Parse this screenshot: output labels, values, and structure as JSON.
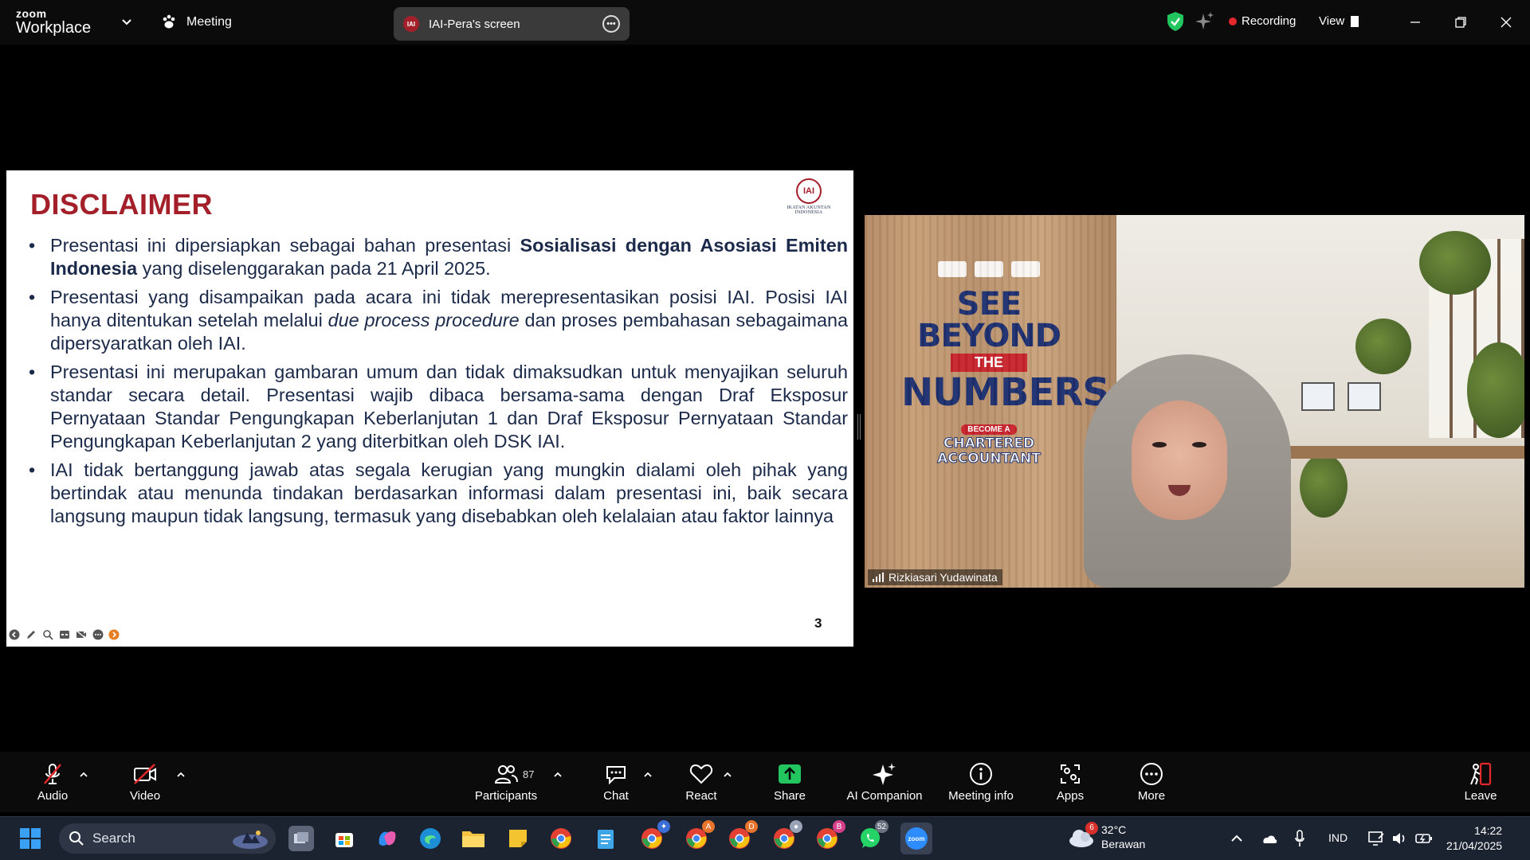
{
  "app": {
    "brand_top": "zoom",
    "brand_bottom": "Workplace",
    "meeting_label": "Meeting",
    "screen_share_title": "IAI-Pera's screen",
    "screen_share_logo": "IAI",
    "recording_label": "Recording",
    "view_label": "View",
    "recording_color": "#e5282c"
  },
  "slide": {
    "title": "DISCLAIMER",
    "logo_text": "IAI",
    "logo_sub": "IKATAN AKUNTAN INDONESIA",
    "page_number": "3",
    "bullets": [
      {
        "parts": [
          {
            "t": "Presentasi ini dipersiapkan sebagai bahan presentasi "
          },
          {
            "t": "Sosialisasi dengan Asosiasi Emiten Indonesia",
            "b": true
          },
          {
            "t": " yang diselenggarakan pada 21 April 2025."
          }
        ]
      },
      {
        "parts": [
          {
            "t": "Presentasi yang disampaikan pada acara ini tidak merepresentasikan posisi IAI. Posisi IAI hanya ditentukan setelah melalui "
          },
          {
            "t": "due process procedure",
            "i": true
          },
          {
            "t": " dan proses pembahasan sebagaimana dipersyaratkan oleh IAI."
          }
        ]
      },
      {
        "parts": [
          {
            "t": "Presentasi ini merupakan gambaran umum dan tidak dimaksudkan untuk menyajikan seluruh standar secara detail. Presentasi wajib dibaca bersama-sama dengan Draf Eksposur Pernyataan Standar Pengungkapan Keberlanjutan 1 dan Draf Eksposur Pernyataan Standar Pengungkapan Keberlanjutan 2 yang diterbitkan oleh DSK IAI."
          }
        ]
      },
      {
        "parts": [
          {
            "t": "IAI tidak bertanggung jawab atas segala kerugian yang mungkin dialami oleh pihak yang bertindak atau menunda tindakan berdasarkan informasi dalam presentasi ini, baik secara langsung maupun tidak langsung, termasuk yang disebabkan oleh kelalaian atau faktor lainnya"
          }
        ]
      }
    ]
  },
  "video": {
    "participant_name": "Rizkiasari Yudawinata",
    "poster": {
      "line1": "SEE BEYOND",
      "line2": "THE",
      "line3": "NUMBERS",
      "line4": "BECOME A",
      "line5a": "CHARTERED",
      "line5b": "ACCOUNTANT"
    }
  },
  "toolbar": {
    "audio": "Audio",
    "video": "Video",
    "participants": "Participants",
    "participants_count": "87",
    "chat": "Chat",
    "react": "React",
    "share": "Share",
    "ai_companion": "AI Companion",
    "meeting_info": "Meeting info",
    "apps": "Apps",
    "more": "More",
    "leave": "Leave",
    "share_color": "#22c55e",
    "leave_color": "#e5282c"
  },
  "taskbar": {
    "search_label": "Search",
    "badge_whatsapp": "52",
    "badge_chrome_a": "A",
    "badge_chrome_d": "D",
    "badge_chrome_b": "B",
    "weather_badge": "6",
    "weather_temp": "32°C",
    "weather_desc": "Berawan",
    "language": "IND",
    "time": "14:22",
    "date": "21/04/2025"
  }
}
